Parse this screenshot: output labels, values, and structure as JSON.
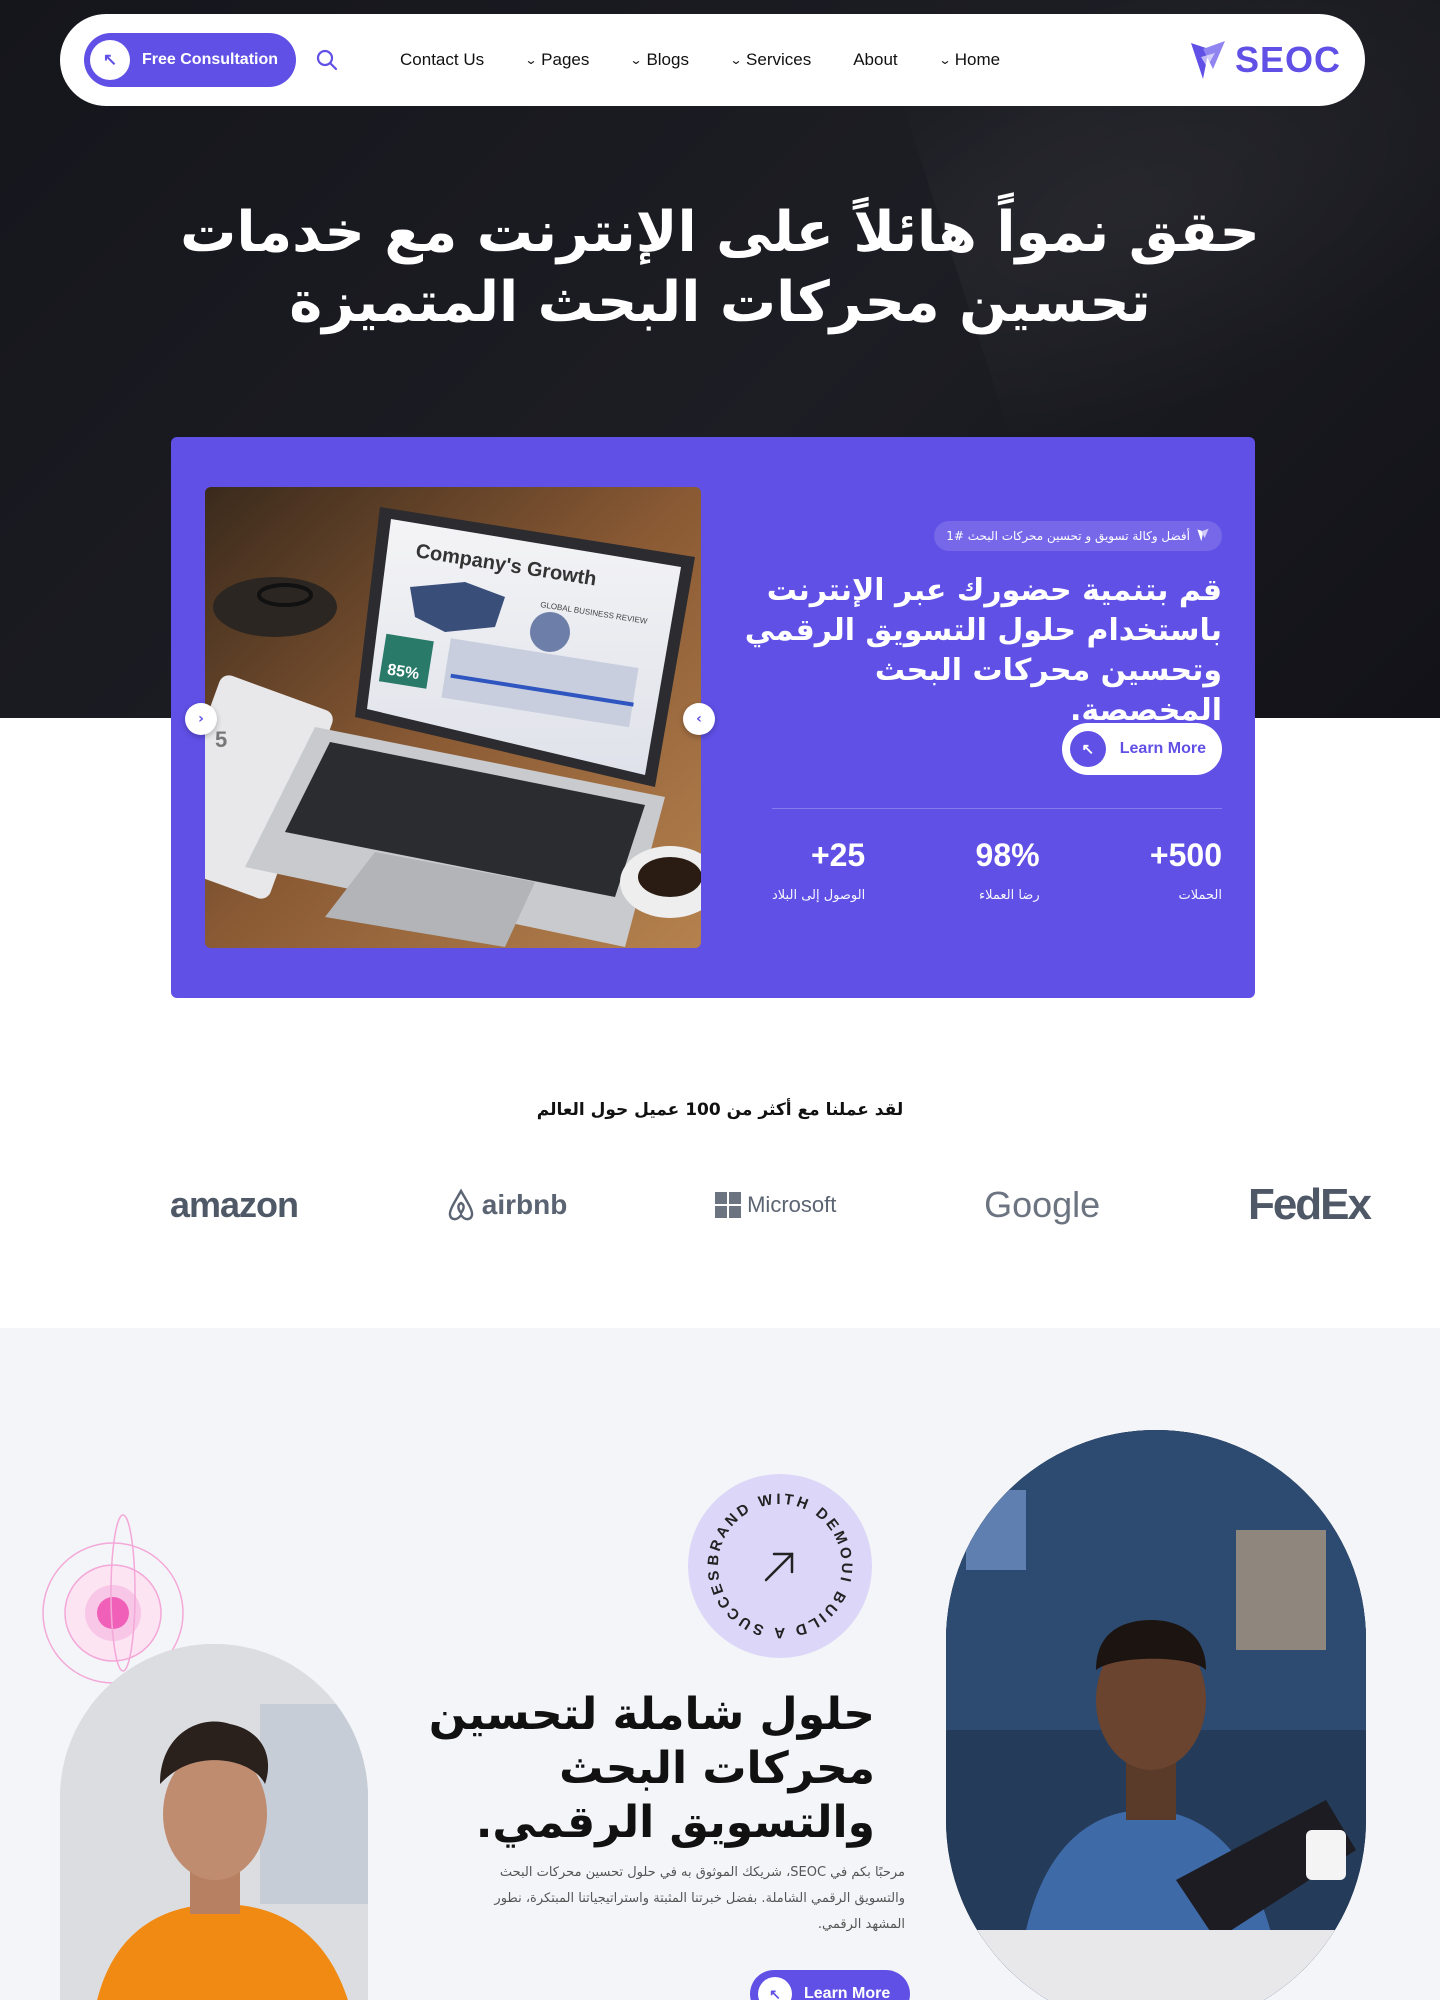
{
  "header": {
    "consult_label": "Free Consultation",
    "nav": [
      {
        "label": "Contact Us",
        "dropdown": false
      },
      {
        "label": "Pages",
        "dropdown": true
      },
      {
        "label": "Blogs",
        "dropdown": true
      },
      {
        "label": "Services",
        "dropdown": true
      },
      {
        "label": "About",
        "dropdown": false
      },
      {
        "label": "Home",
        "dropdown": true
      }
    ],
    "logo_text": "SEOC"
  },
  "hero": {
    "title_line1": "حقق نمواً هائلاً على الإنترنت مع خدمات",
    "title_line2": "تحسين محركات البحث المتميزة"
  },
  "card": {
    "badge": "أفضل وكالة تسويق و تحسين محركات البحث #1",
    "heading_line1": "قم بتنمية حضورك عبر الإنترنت",
    "heading_line2": "باستخدام حلول التسويق الرقمي",
    "heading_line3": "وتحسين محركات البحث المخصصة.",
    "learn_more": "Learn More",
    "stats": [
      {
        "value": "+500",
        "label": "الحملات"
      },
      {
        "value": "98%",
        "label": "رضا العملاء"
      },
      {
        "value": "+25",
        "label": "الوصول إلى البلاد"
      }
    ],
    "photo": {
      "screen_title": "Company's Growth",
      "screen_subtitle": "GLOBAL BUSINESS REVIEW",
      "screen_percent": "85%",
      "side_number": "5"
    }
  },
  "clients": {
    "title": "لقد عملنا مع أكثر من 100 عميل حول العالم",
    "logos": [
      "amazon",
      "airbnb",
      "Microsoft",
      "Google",
      "FedEx"
    ]
  },
  "section": {
    "badge_text": "BRAND WITH DEMOUI BUILD A SUCCESS",
    "title_line1": "حلول شاملة لتحسين",
    "title_line2": "محركات البحث",
    "title_line3": "والتسويق الرقمي.",
    "text": "مرحبًا بكم في SEOC، شريكك الموثوق به في حلول تحسين محركات البحث والتسويق الرقمي الشاملة. بفضل خبرتنا المثبتة واستراتيجياتنا المبتكرة، نطور المشهد الرقمي.",
    "button": "Learn More"
  },
  "colors": {
    "accent": "#6050e6",
    "dark_bg": "#17171d",
    "light_bg": "#f4f5f8"
  },
  "icons": [
    "arrow-up-left-icon",
    "search-icon",
    "chevron-down-icon",
    "logo-icon",
    "chevron-left-icon",
    "chevron-right-icon",
    "badge-logo-icon",
    "arrow-up-right-icon"
  ]
}
